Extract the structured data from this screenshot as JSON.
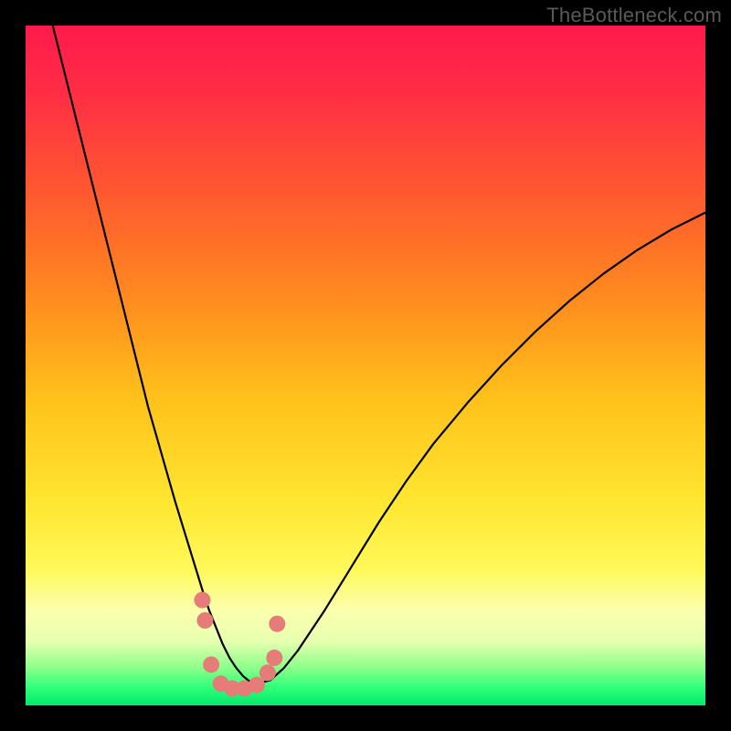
{
  "watermark": "TheBottleneck.com",
  "chart_data": {
    "type": "line",
    "title": "",
    "xlabel": "",
    "ylabel": "",
    "xlim": [
      0,
      100
    ],
    "ylim": [
      0,
      100
    ],
    "background_gradient_stops": [
      {
        "offset": 0.0,
        "color": "#ff1a4d"
      },
      {
        "offset": 0.1,
        "color": "#ff2e44"
      },
      {
        "offset": 0.25,
        "color": "#ff5a2f"
      },
      {
        "offset": 0.4,
        "color": "#ff8a1f"
      },
      {
        "offset": 0.55,
        "color": "#ffc21a"
      },
      {
        "offset": 0.7,
        "color": "#ffe630"
      },
      {
        "offset": 0.8,
        "color": "#fff95a"
      },
      {
        "offset": 0.86,
        "color": "#fcffad"
      },
      {
        "offset": 0.905,
        "color": "#e8ffb0"
      },
      {
        "offset": 0.945,
        "color": "#8bff8a"
      },
      {
        "offset": 0.975,
        "color": "#2cff7a"
      },
      {
        "offset": 1.0,
        "color": "#00e86a"
      }
    ],
    "series": [
      {
        "name": "bottleneck-curve",
        "stroke": "#000000",
        "stroke_width": 2.2,
        "x": [
          4,
          6,
          8,
          10,
          12,
          14,
          16,
          18,
          20,
          22,
          24,
          26,
          27,
          28,
          29,
          30,
          31,
          32,
          33,
          34,
          36,
          38,
          40,
          44,
          48,
          52,
          56,
          60,
          65,
          70,
          75,
          80,
          85,
          90,
          95,
          100
        ],
        "y": [
          100,
          92,
          84,
          76,
          68,
          60,
          52,
          44,
          37,
          30,
          23.5,
          17,
          14,
          11.5,
          9,
          7,
          5.5,
          4.3,
          3.5,
          3.2,
          3.7,
          5.5,
          8,
          14,
          20.5,
          27,
          33,
          38.5,
          44.5,
          50,
          55,
          59.5,
          63.5,
          67,
          70,
          72.5
        ]
      }
    ],
    "markers": {
      "name": "highlight-dots",
      "fill": "#e57c78",
      "radius": 9,
      "points": [
        {
          "x": 26.0,
          "y": 15.5
        },
        {
          "x": 26.4,
          "y": 12.5
        },
        {
          "x": 27.3,
          "y": 6.0
        },
        {
          "x": 28.7,
          "y": 3.2
        },
        {
          "x": 30.4,
          "y": 2.5
        },
        {
          "x": 32.2,
          "y": 2.5
        },
        {
          "x": 34.0,
          "y": 3.0
        },
        {
          "x": 35.6,
          "y": 4.8
        },
        {
          "x": 36.6,
          "y": 7.0
        },
        {
          "x": 37.0,
          "y": 12.0
        }
      ]
    }
  }
}
